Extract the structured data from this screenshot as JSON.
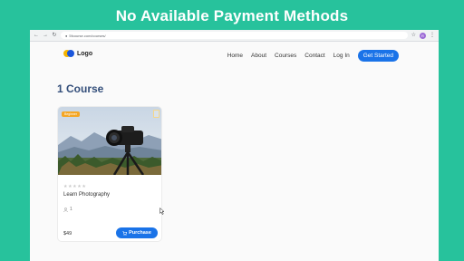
{
  "banner": {
    "title": "No Available Payment Methods"
  },
  "browser": {
    "url": "5fcourse.com/courses/",
    "profile_initial": "R"
  },
  "header": {
    "logo_text": "Logo",
    "nav": [
      "Home",
      "About",
      "Courses",
      "Contact",
      "Log In"
    ],
    "cta": "Get Started"
  },
  "page": {
    "title": "1 Course"
  },
  "course": {
    "badge": "Beginner",
    "name": "Learn Photography",
    "rating_stars": 5,
    "enrolled": "1",
    "price": "$49",
    "purchase_label": "Purchase"
  },
  "colors": {
    "banner_bg": "#27c29c",
    "primary": "#1a73e8",
    "title": "#334e7a",
    "badge": "#f5a623"
  }
}
